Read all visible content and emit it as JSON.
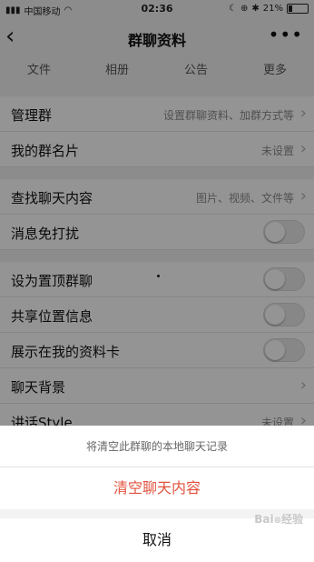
{
  "status": {
    "carrier": "中国移动",
    "time": "02:36",
    "battery": "21%",
    "battery_fraction": 0.21
  },
  "nav": {
    "back_glyph": "‹",
    "title": "群聊资料",
    "more_glyph": "•••"
  },
  "tabs": [
    "文件",
    "相册",
    "公告",
    "更多"
  ],
  "rows": [
    {
      "label": "管理群",
      "value": "设置群聊资料、加群方式等"
    },
    {
      "label": "我的群名片",
      "value": "未设置"
    },
    {
      "label": "查找聊天内容",
      "value": "图片、视频、文件等"
    },
    {
      "label": "消息免打扰"
    },
    {
      "label": "设为置顶群聊"
    },
    {
      "label": "共享位置信息"
    },
    {
      "label": "展示在我的资料卡"
    },
    {
      "label": "聊天背景"
    },
    {
      "label": "讲话Style",
      "value": "未设置"
    }
  ],
  "sheet": {
    "message": "将清空此群聊的本地聊天记录",
    "confirm_label": "清空聊天内容",
    "cancel_label": "取消"
  },
  "colors": {
    "danger": "#e1533e",
    "toggle_off": "#e9e9e9"
  },
  "watermark": "Baidu 经验"
}
